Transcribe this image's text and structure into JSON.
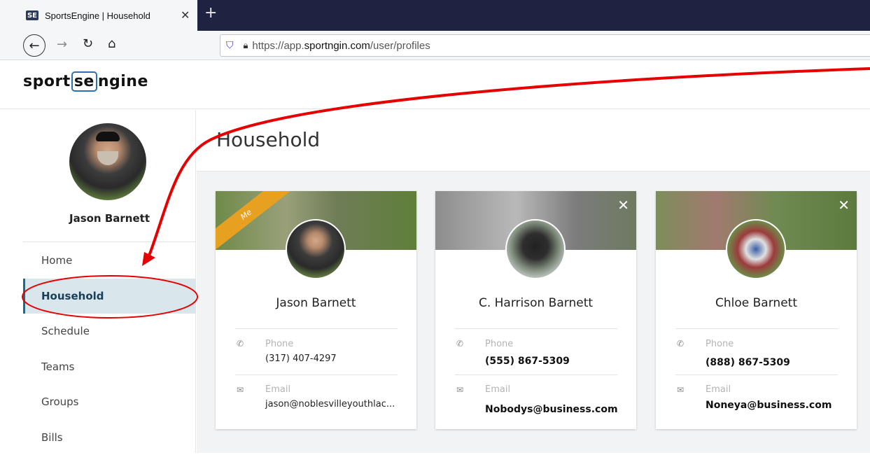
{
  "browser": {
    "tab_title": "SportsEngine | Household",
    "favicon": "SE",
    "close": "✕",
    "new_tab": "+",
    "url_prefix": "https://app.",
    "url_domain": "sportngin.com",
    "url_path": "/user/profiles"
  },
  "site": {
    "logo_left": "sport",
    "logo_mid": "se",
    "logo_right": "ngine"
  },
  "sidebar": {
    "user_name": "Jason Barnett",
    "items": [
      {
        "label": "Home"
      },
      {
        "label": "Household"
      },
      {
        "label": "Schedule"
      },
      {
        "label": "Teams"
      },
      {
        "label": "Groups"
      },
      {
        "label": "Bills"
      }
    ]
  },
  "main": {
    "title": "Household",
    "cards": [
      {
        "name": "Jason Barnett",
        "badge": "Me",
        "phone_label": "Phone",
        "phone": "(317) 407-4297",
        "email_label": "Email",
        "email": "jason@noblesvilleyouthlac..."
      },
      {
        "name": "C. Harrison Barnett",
        "phone_label": "Phone",
        "phone": "(555) 867-5309",
        "email_label": "Email",
        "email": "Nobodys@business.com"
      },
      {
        "name": "Chloe Barnett",
        "phone_label": "Phone",
        "phone": "(888) 867-5309",
        "email_label": "Email",
        "email": "Noneya@business.com"
      }
    ]
  },
  "colors": {
    "accent": "#1d6a8f",
    "active_bg": "#d9e6ec",
    "me_ribbon": "#e8a020",
    "annotation": "#e60000"
  }
}
